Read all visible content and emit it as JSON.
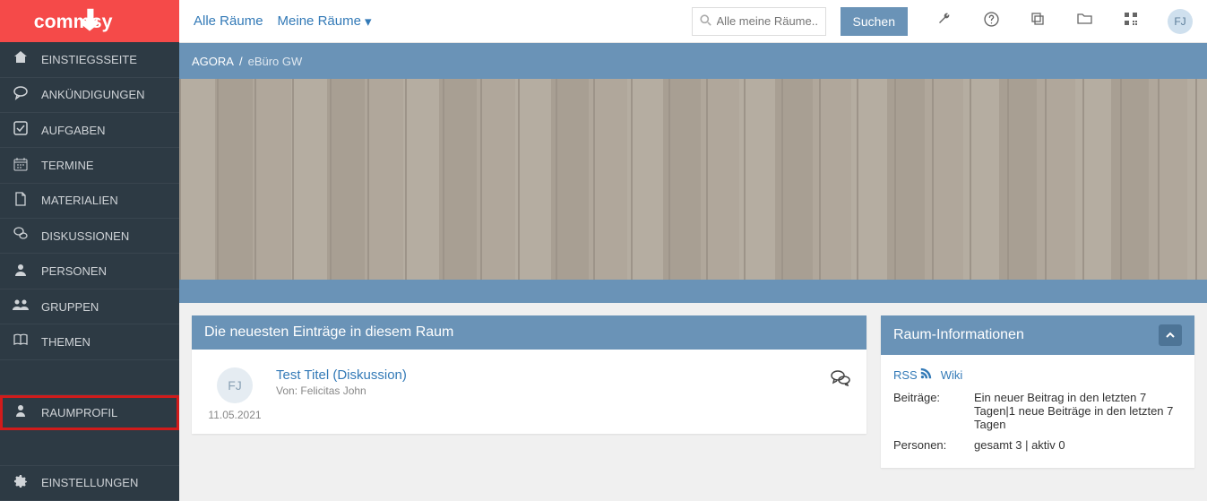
{
  "brand": "commsy",
  "sidebar": {
    "items": [
      {
        "icon": "home",
        "label": "EINSTIEGSSEITE"
      },
      {
        "icon": "ann",
        "label": "ANKÜNDIGUNGEN"
      },
      {
        "icon": "task",
        "label": "AUFGABEN"
      },
      {
        "icon": "cal",
        "label": "TERMINE"
      },
      {
        "icon": "doc",
        "label": "MATERIALIEN"
      },
      {
        "icon": "disc",
        "label": "DISKUSSIONEN"
      },
      {
        "icon": "person",
        "label": "PERSONEN"
      },
      {
        "icon": "group",
        "label": "GRUPPEN"
      },
      {
        "icon": "book",
        "label": "THEMEN"
      }
    ],
    "profile": {
      "icon": "profile",
      "label": "RAUMPROFIL"
    },
    "settings": {
      "icon": "gear",
      "label": "EINSTELLUNGEN"
    }
  },
  "topbar": {
    "link1": "Alle Räume",
    "link2": "Meine Räume",
    "search_placeholder": "Alle meine Räume...",
    "search_button": "Suchen",
    "avatar": "FJ"
  },
  "breadcrumb": {
    "root": "AGORA",
    "sep": "/",
    "current": "eBüro GW"
  },
  "latest_panel": {
    "title": "Die neuesten Einträge in diesem Raum",
    "entry": {
      "avatar": "FJ",
      "date": "11.05.2021",
      "title": "Test Titel (Diskussion)",
      "by": "Von: Felicitas John"
    }
  },
  "info_panel": {
    "title": "Raum-Informationen",
    "rss": "RSS",
    "wiki": "Wiki",
    "rows": [
      {
        "key": "Beiträge:",
        "val": "Ein neuer Beitrag in den letzten 7 Tagen|1 neue Beiträge in den letzten 7 Tagen"
      },
      {
        "key": "Personen:",
        "val": "gesamt 3 | aktiv 0"
      }
    ]
  }
}
